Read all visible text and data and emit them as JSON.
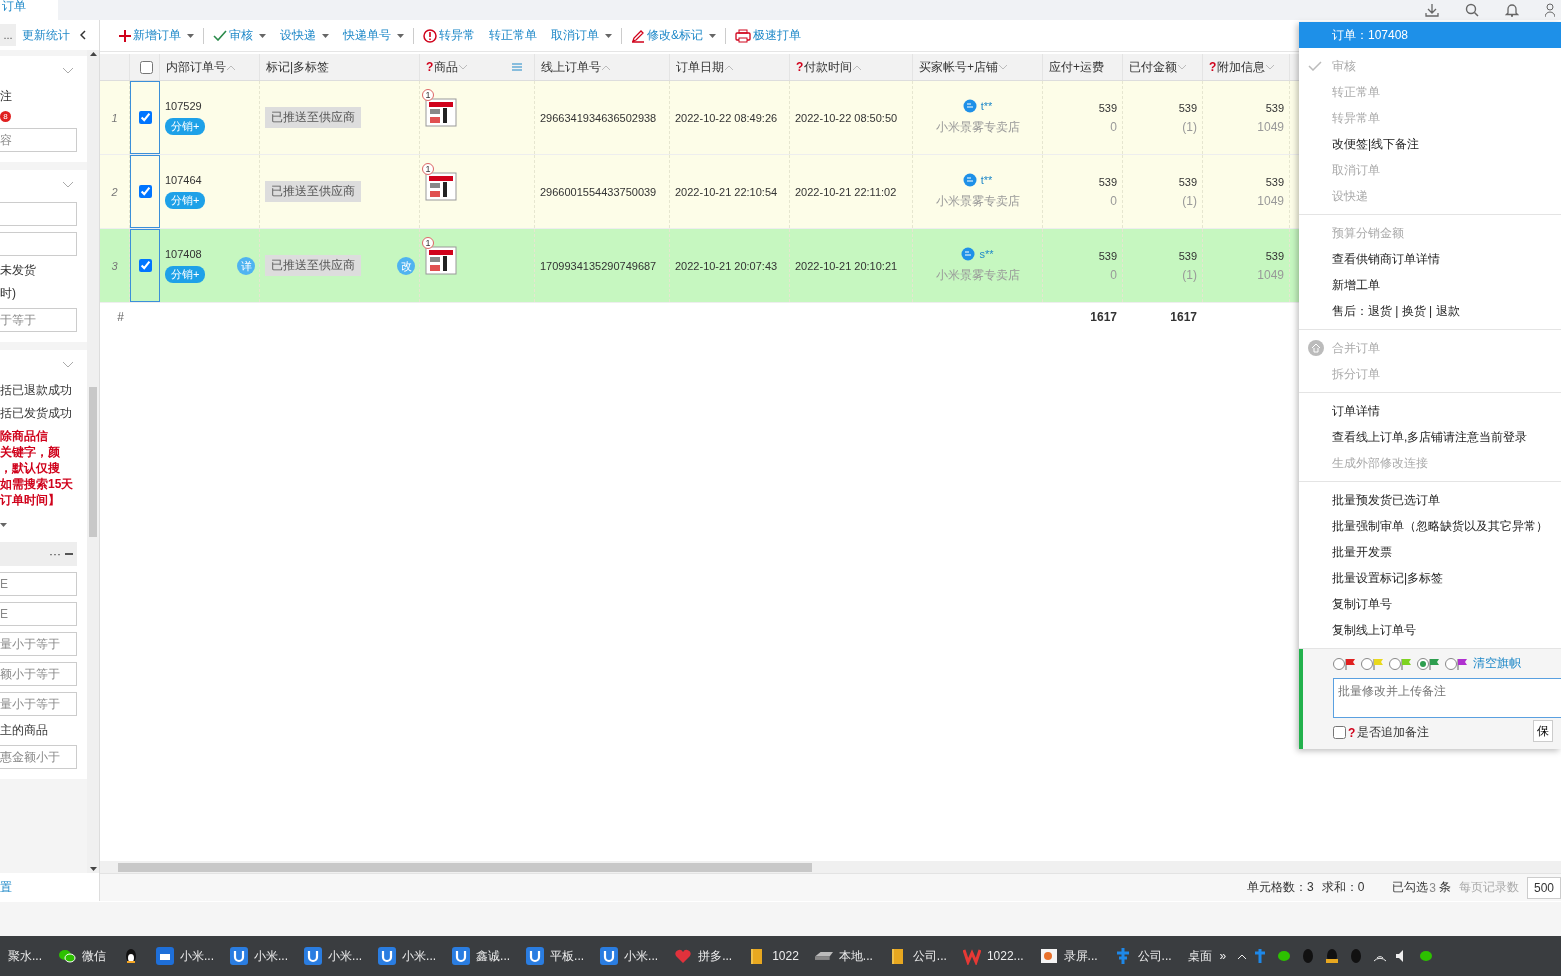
{
  "top_tab": {
    "label": "订单"
  },
  "left_panel": {
    "more": "...",
    "refresh": "更新统计",
    "sections": [
      {
        "items": [
          {
            "kind": "text",
            "text": "注"
          },
          {
            "kind": "badge",
            "text": "8"
          },
          {
            "kind": "field",
            "text": "容"
          }
        ]
      },
      {
        "items": [
          {
            "kind": "field"
          },
          {
            "kind": "field"
          },
          {
            "kind": "text",
            "text": "未发货"
          },
          {
            "kind": "text",
            "text": "时)"
          },
          {
            "kind": "field",
            "text": "于等于"
          }
        ]
      },
      {
        "items": [
          {
            "kind": "text",
            "text": "括已退款成功"
          },
          {
            "kind": "text",
            "text": "括已发货成功"
          },
          {
            "kind": "alert",
            "lines": [
              "除商品信",
              "关键字，颜",
              "，默认仅搜",
              "如需搜索15天",
              "订单时间】"
            ]
          },
          {
            "kind": "select"
          },
          {
            "kind": "range",
            "text": "···"
          },
          {
            "kind": "field",
            "text": "E"
          },
          {
            "kind": "field",
            "text": "E"
          },
          {
            "kind": "field",
            "text": "量小于等于"
          },
          {
            "kind": "field",
            "text": "额小于等于"
          },
          {
            "kind": "field",
            "text": "量小于等于"
          },
          {
            "kind": "text",
            "text": "主的商品"
          },
          {
            "kind": "field",
            "text": "惠金额小于"
          }
        ]
      }
    ],
    "footer_link": "置"
  },
  "toolbar": [
    {
      "label": "新增订单",
      "kind": "plus",
      "has_menu": true,
      "divider_after": true
    },
    {
      "label": "审核",
      "kind": "check",
      "has_menu": true,
      "divider_after": false
    },
    {
      "label": "设快递",
      "kind": "plain",
      "has_menu": true,
      "divider_after": false
    },
    {
      "label": "快递单号",
      "kind": "plain",
      "has_menu": true,
      "divider_after": true
    },
    {
      "label": "转异常",
      "kind": "alert",
      "has_menu": false,
      "divider_after": false
    },
    {
      "label": "转正常单",
      "kind": "plain",
      "has_menu": false,
      "divider_after": false
    },
    {
      "label": "取消订单",
      "kind": "plain",
      "has_menu": true,
      "divider_after": true
    },
    {
      "label": "修改&标记",
      "kind": "pen",
      "has_menu": true,
      "divider_after": true
    },
    {
      "label": "极速打单",
      "kind": "printer",
      "has_menu": false,
      "divider_after": false
    }
  ],
  "table": {
    "all_checked": false,
    "columns": [
      {
        "label": "内部订单号",
        "kind": "sort_up"
      },
      {
        "label": "标记|多标签",
        "kind": "plain"
      },
      {
        "label": "商品",
        "help_mark": "?",
        "kind": "sort_down"
      },
      {
        "label": "线上订单号",
        "kind": "sort_up"
      },
      {
        "label": "订单日期",
        "kind": "sort_up"
      },
      {
        "label": "付款时间",
        "help_mark": "?",
        "kind": "sort_up"
      },
      {
        "label": "买家帐号+店铺",
        "kind": "sort_down"
      },
      {
        "label": "应付+运费",
        "kind": "plain"
      },
      {
        "label": "已付金额",
        "kind": "sort_down"
      },
      {
        "label": "附加信息",
        "help_mark": "?",
        "kind": "sort_down"
      }
    ],
    "rows": [
      {
        "index": "1",
        "checked": true,
        "selected": false,
        "id": "107529",
        "tag": "分销+",
        "mark": "已推送至供应商",
        "qty": "1",
        "online_no": "2966341934636502938",
        "date": "2022-10-22 08:49:26",
        "paid_at": "2022-10-22 08:50:50",
        "buyer": "t**",
        "shop": "小米景雾专卖店",
        "payable": "539",
        "freight": "0",
        "paid": "539",
        "paid_count": "(1)",
        "extra": "539",
        "extra_2": "1049"
      },
      {
        "index": "2",
        "checked": true,
        "selected": false,
        "id": "107464",
        "tag": "分销+",
        "mark": "已推送至供应商",
        "qty": "1",
        "online_no": "2966001554433750039",
        "date": "2022-10-21 22:10:54",
        "paid_at": "2022-10-21 22:11:02",
        "buyer": "t**",
        "shop": "小米景雾专卖店",
        "payable": "539",
        "freight": "0",
        "paid": "539",
        "paid_count": "(1)",
        "extra": "539",
        "extra_2": "1049"
      },
      {
        "index": "3",
        "checked": true,
        "selected": true,
        "id": "107408",
        "tag": "分销+",
        "detail": "详",
        "mark": "已推送至供应商",
        "edit": "改",
        "qty": "1",
        "online_no": "1709934135290749687",
        "date": "2022-10-21 20:07:43",
        "paid_at": "2022-10-21 20:10:21",
        "buyer": "s**",
        "shop": "小米景雾专卖店",
        "payable": "539",
        "freight": "0",
        "paid": "539",
        "paid_count": "(1)",
        "extra": "539",
        "extra_2": "1049"
      }
    ],
    "footer": {
      "mark": "#",
      "payable_sum": "1617",
      "paid_sum": "1617"
    }
  },
  "context_menu": {
    "title": "订单：107408",
    "groups": [
      [
        {
          "label": "审核",
          "disabled": true,
          "kind": "check"
        },
        {
          "label": "转正常单",
          "disabled": true,
          "kind": "plain"
        },
        {
          "label": "转异常单",
          "disabled": true,
          "kind": "plain"
        },
        {
          "label": "改便签|线下备注",
          "disabled": false,
          "kind": "plain"
        },
        {
          "label": "取消订单",
          "disabled": true,
          "kind": "plain"
        },
        {
          "label": "设快递",
          "disabled": true,
          "kind": "plain"
        }
      ],
      [
        {
          "label": "预算分销金额",
          "disabled": true,
          "kind": "plain"
        },
        {
          "label": "查看供销商订单详情",
          "disabled": false,
          "kind": "plain"
        },
        {
          "label": "新增工单",
          "disabled": false,
          "kind": "plain"
        },
        {
          "label": "售后：退货 | 换货 | 退款",
          "disabled": false,
          "kind": "plain"
        }
      ],
      [
        {
          "label": "合并订单",
          "disabled": true,
          "kind": "merge"
        },
        {
          "label": "拆分订单",
          "disabled": true,
          "kind": "plain"
        }
      ],
      [
        {
          "label": "订单详情",
          "disabled": false,
          "kind": "plain"
        },
        {
          "label": "查看线上订单,多店铺请注意当前登录",
          "disabled": false,
          "kind": "plain"
        },
        {
          "label": "生成外部修改连接",
          "disabled": true,
          "kind": "plain"
        }
      ],
      [
        {
          "label": "批量预发货已选订单",
          "disabled": false,
          "kind": "plain"
        },
        {
          "label": "批量强制审单（忽略缺货以及其它异常）",
          "disabled": false,
          "kind": "plain"
        },
        {
          "label": "批量开发票",
          "disabled": false,
          "kind": "plain"
        },
        {
          "label": "批量设置标记|多标签",
          "disabled": false,
          "kind": "plain"
        },
        {
          "label": "复制订单号",
          "disabled": false,
          "kind": "plain"
        },
        {
          "label": "复制线上订单号",
          "disabled": false,
          "kind": "plain"
        }
      ]
    ],
    "flags": [
      {
        "color": "#e02020",
        "selected": false
      },
      {
        "color": "#e8d81c",
        "selected": false
      },
      {
        "color": "#7ed321",
        "selected": false
      },
      {
        "color": "#2e9e4f",
        "selected": true
      },
      {
        "color": "#b030d0",
        "selected": false
      }
    ],
    "clear_flags": "清空旗帜",
    "remark": {
      "placeholder": "批量修改并上传备注"
    },
    "append": {
      "help_mark": "?",
      "label": "是否追加备注",
      "checked": false
    },
    "save": "保"
  },
  "status_bar": {
    "cells": "单元格数：3",
    "sum": "求和：0",
    "checked_label": "已勾选",
    "checked_count": "3",
    "checked_unit": "条",
    "page_size_label": "每页记录数",
    "page_size": "500"
  },
  "taskbar": {
    "items": [
      {
        "label": "聚水...",
        "kind": "plain"
      },
      {
        "label": "微信",
        "kind": "chat"
      },
      {
        "kind": "penguin"
      },
      {
        "label": "小米...",
        "kind": "store"
      },
      {
        "label": "小米...",
        "kind": "app"
      },
      {
        "label": "小米...",
        "kind": "app"
      },
      {
        "label": "小米...",
        "kind": "app"
      },
      {
        "label": "鑫诚...",
        "kind": "app"
      },
      {
        "label": "平板...",
        "kind": "app"
      },
      {
        "label": "小米...",
        "kind": "app"
      },
      {
        "label": "拼多...",
        "kind": "heart"
      },
      {
        "label": "1022",
        "kind": "folder"
      },
      {
        "label": "本地...",
        "kind": "drive"
      },
      {
        "label": "公司...",
        "kind": "folder"
      },
      {
        "label": "1022...",
        "kind": "office"
      },
      {
        "label": "录屏...",
        "kind": "media"
      },
      {
        "label": "公司...",
        "kind": "pin"
      },
      {
        "label": "桌面",
        "kind": "plain"
      }
    ],
    "overflow": "»"
  }
}
